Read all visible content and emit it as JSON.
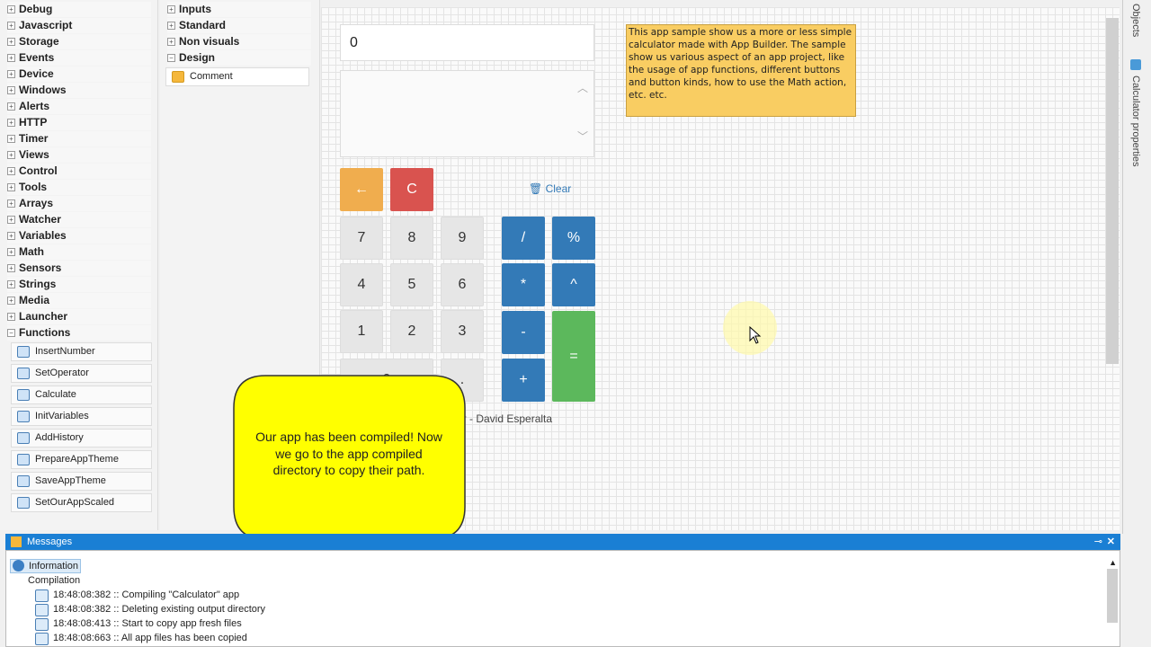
{
  "left_tree": {
    "categories": [
      "Debug",
      "Javascript",
      "Storage",
      "Events",
      "Device",
      "Windows",
      "Alerts",
      "HTTP",
      "Timer",
      "Views",
      "Control",
      "Tools",
      "Arrays",
      "Watcher",
      "Variables",
      "Math",
      "Sensors",
      "Strings",
      "Media",
      "Launcher"
    ],
    "functions_label": "Functions",
    "functions": [
      "InsertNumber",
      "SetOperator",
      "Calculate",
      "InitVariables",
      "AddHistory",
      "PrepareAppTheme",
      "SaveAppTheme",
      "SetOurAppScaled"
    ]
  },
  "components": {
    "categories": [
      "Inputs",
      "Standard",
      "Non visuals"
    ],
    "design_label": "Design",
    "design_items": [
      "Comment"
    ]
  },
  "calculator": {
    "display": "0",
    "backspace": "←",
    "clear_c": "C",
    "clear_link": "Clear",
    "numbers": [
      "7",
      "8",
      "9",
      "4",
      "5",
      "6",
      "1",
      "2",
      "3"
    ],
    "zero": "0",
    "dot": ".",
    "ops": {
      "div": "/",
      "pct": "%",
      "mul": "*",
      "pow": "^",
      "sub": "-",
      "add": "+",
      "eq": "="
    },
    "footer": "er - David Esperalta"
  },
  "comment_note": "This app sample show us a more or less simple calculator made with App Builder. The sample show us various aspect of an app project, like the usage of app functions, different buttons and button kinds, how to use the Math action, etc. etc.",
  "bubble": "Our app has been compiled! Now we go to the app compiled directory to copy their path.",
  "right_tabs": [
    "Objects",
    "Calculator properties"
  ],
  "messages": {
    "title": "Messages",
    "info": "Information",
    "group": "Compilation",
    "logs": [
      "18:48:08:382 :: Compiling \"Calculator\" app",
      "18:48:08:382 :: Deleting existing output directory",
      "18:48:08:413 :: Start to copy app fresh files",
      "18:48:08:663 :: All app files has been copied"
    ]
  },
  "colors": {
    "orange": "#f0ad4e",
    "red": "#d9534f",
    "blue": "#337ab7",
    "green": "#5cb85c",
    "note": "#f9cd62",
    "bubble": "#ffff00",
    "header": "#1a7fd4"
  }
}
